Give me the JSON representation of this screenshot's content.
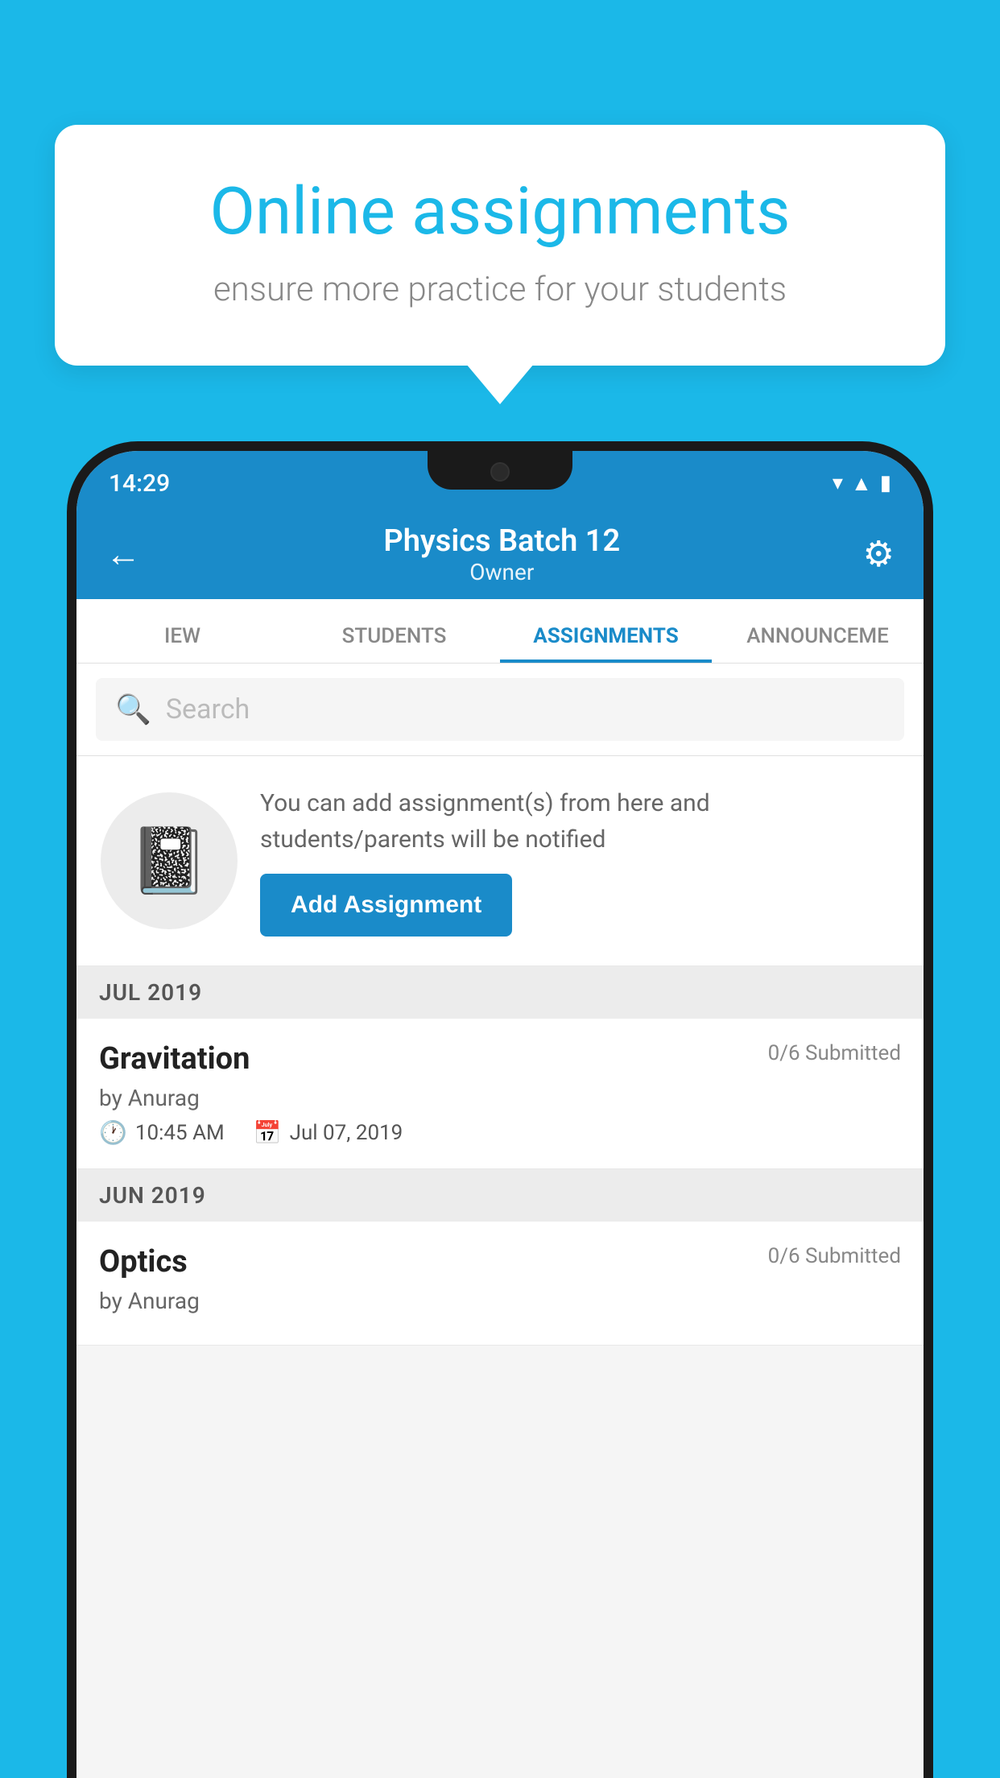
{
  "background_color": "#1bb8e8",
  "speech_bubble": {
    "title": "Online assignments",
    "subtitle": "ensure more practice for your students"
  },
  "status_bar": {
    "time": "14:29",
    "icons": [
      "wifi",
      "signal",
      "battery"
    ]
  },
  "header": {
    "title": "Physics Batch 12",
    "subtitle": "Owner",
    "back_label": "←",
    "settings_label": "⚙"
  },
  "tabs": [
    {
      "label": "IEW",
      "active": false
    },
    {
      "label": "STUDENTS",
      "active": false
    },
    {
      "label": "ASSIGNMENTS",
      "active": true
    },
    {
      "label": "ANNOUNCEME",
      "active": false
    }
  ],
  "search": {
    "placeholder": "Search"
  },
  "promo": {
    "text": "You can add assignment(s) from here and students/parents will be notified",
    "button_label": "Add Assignment"
  },
  "sections": [
    {
      "label": "JUL 2019",
      "assignments": [
        {
          "title": "Gravitation",
          "submitted": "0/6 Submitted",
          "author": "by Anurag",
          "time": "10:45 AM",
          "date": "Jul 07, 2019"
        }
      ]
    },
    {
      "label": "JUN 2019",
      "assignments": [
        {
          "title": "Optics",
          "submitted": "0/6 Submitted",
          "author": "by Anurag",
          "time": "",
          "date": ""
        }
      ]
    }
  ]
}
